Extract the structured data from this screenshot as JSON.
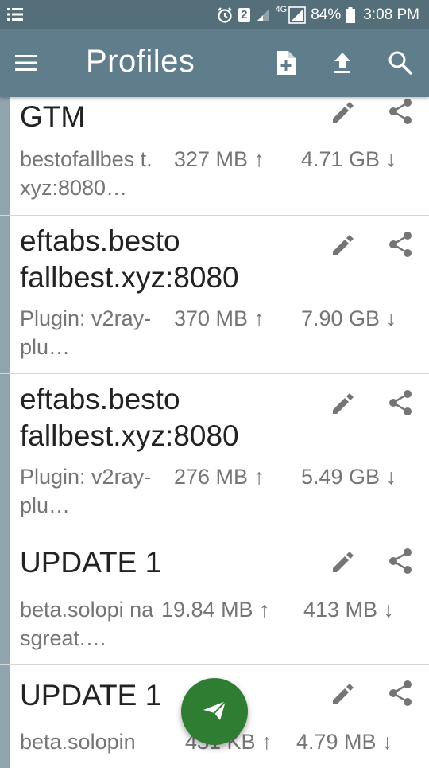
{
  "status_bar": {
    "battery": "84%",
    "time": "3:08 PM",
    "sim_badge": "2",
    "network": "4G"
  },
  "app_bar": {
    "title": "Profiles",
    "actions": [
      "add-file-icon",
      "upload-icon",
      "search-icon"
    ]
  },
  "profiles": [
    {
      "name": "GTM",
      "host": "bestofallbes t.xyz:8080…",
      "tx": "327 MB ↑",
      "rx": "4.71 GB ↓"
    },
    {
      "name": "eftabs.besto fallbest.xyz:8080",
      "host": "Plugin: v2ray-plu…",
      "tx": "370 MB ↑",
      "rx": "7.90 GB ↓"
    },
    {
      "name": "eftabs.besto fallbest.xyz:8080",
      "host": "Plugin: v2ray-plu…",
      "tx": "276 MB ↑",
      "rx": "5.49 GB ↓"
    },
    {
      "name": "UPDATE 1",
      "host": "beta.solopi nasgreat.…",
      "tx": "19.84 MB ↑",
      "rx": "413 MB ↓"
    },
    {
      "name": "UPDATE 1",
      "host": "beta.solopin",
      "tx": "431 KB ↑",
      "rx": "4.79 MB ↓"
    }
  ],
  "colors": {
    "status_bar": "#546e7a",
    "app_bar": "#607d8b",
    "card_edge": "#90a4ae",
    "fab": "#2e7d32"
  }
}
